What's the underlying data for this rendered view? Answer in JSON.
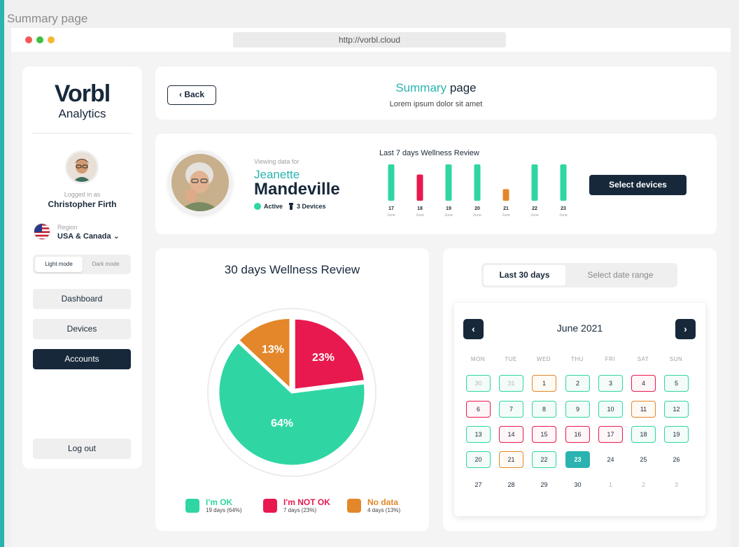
{
  "window": {
    "title": "Summary page",
    "url": "http://vorbl.cloud"
  },
  "colors": {
    "accent": "#2ab3b0",
    "dark": "#17283a",
    "ok": "#2fd6a3",
    "not_ok": "#e8194f",
    "no_data": "#e3872a"
  },
  "sidebar": {
    "logo_word": "Vorbl",
    "logo_sub": "Analytics",
    "logged_label": "Logged in as",
    "user_name": "Christopher Firth",
    "region_label": "Region",
    "region_value": "USA & Canada",
    "mode_light": "Light mode",
    "mode_dark": "Dark mode",
    "nav": {
      "dashboard": "Dashboard",
      "devices": "Devices",
      "accounts": "Accounts",
      "logout": "Log out"
    }
  },
  "header": {
    "back": "Back",
    "title_accent": "Summary",
    "title_rest": "page",
    "subtitle": "Lorem ipsum dolor sit amet"
  },
  "profile": {
    "viewing_label": "Viewing data for",
    "first_name": "Jeanette",
    "last_name": "Mandeville",
    "status": "Active",
    "devices": "3 Devices",
    "weekly_title": "Last 7 days Wellness Review",
    "select_devices": "Select devices"
  },
  "weekly": [
    {
      "day": "17",
      "month": "June",
      "status": "ok",
      "level": 1.0
    },
    {
      "day": "18",
      "month": "June",
      "status": "not_ok",
      "level": 0.72
    },
    {
      "day": "19",
      "month": "June",
      "status": "ok",
      "level": 1.0
    },
    {
      "day": "20",
      "month": "June",
      "status": "ok",
      "level": 1.0
    },
    {
      "day": "21",
      "month": "June",
      "status": "no_data",
      "level": 0.32
    },
    {
      "day": "22",
      "month": "June",
      "status": "ok",
      "level": 1.0
    },
    {
      "day": "23",
      "month": "June",
      "status": "ok",
      "level": 1.0
    }
  ],
  "pie": {
    "title": "30 days Wellness Review",
    "slices": [
      {
        "label": "I'm OK",
        "percent": 64,
        "sub": "19 days (64%)",
        "color": "#2fd6a3"
      },
      {
        "label": "I'm NOT OK",
        "percent": 23,
        "sub": "7 days (23%)",
        "color": "#e8194f"
      },
      {
        "label": "No data",
        "percent": 13,
        "sub": "4 days (13%)",
        "color": "#e3872a"
      }
    ]
  },
  "calendar": {
    "tab_active": "Last 30 days",
    "tab_inactive": "Select date range",
    "month": "June 2021",
    "weekdays": [
      "MON",
      "TUE",
      "WED",
      "THU",
      "FRI",
      "SAT",
      "SUN"
    ],
    "days": [
      {
        "n": "30",
        "s": "ok",
        "m": true
      },
      {
        "n": "31",
        "s": "ok",
        "m": true
      },
      {
        "n": "1",
        "s": "nodata"
      },
      {
        "n": "2",
        "s": "ok"
      },
      {
        "n": "3",
        "s": "ok"
      },
      {
        "n": "4",
        "s": "notok"
      },
      {
        "n": "5",
        "s": "ok"
      },
      {
        "n": "6",
        "s": "notok"
      },
      {
        "n": "7",
        "s": "ok"
      },
      {
        "n": "8",
        "s": "ok"
      },
      {
        "n": "9",
        "s": "ok"
      },
      {
        "n": "10",
        "s": "ok"
      },
      {
        "n": "11",
        "s": "nodata"
      },
      {
        "n": "12",
        "s": "ok"
      },
      {
        "n": "13",
        "s": "ok"
      },
      {
        "n": "14",
        "s": "notok"
      },
      {
        "n": "15",
        "s": "notok"
      },
      {
        "n": "16",
        "s": "notok"
      },
      {
        "n": "17",
        "s": "notok"
      },
      {
        "n": "18",
        "s": "ok"
      },
      {
        "n": "19",
        "s": "ok"
      },
      {
        "n": "20",
        "s": "ok"
      },
      {
        "n": "21",
        "s": "nodata"
      },
      {
        "n": "22",
        "s": "ok"
      },
      {
        "n": "23",
        "s": "today"
      },
      {
        "n": "24",
        "s": "plain"
      },
      {
        "n": "25",
        "s": "plain"
      },
      {
        "n": "26",
        "s": "plain"
      },
      {
        "n": "27",
        "s": "plain"
      },
      {
        "n": "28",
        "s": "plain"
      },
      {
        "n": "29",
        "s": "plain"
      },
      {
        "n": "30",
        "s": "plain"
      },
      {
        "n": "1",
        "s": "plain",
        "m": true
      },
      {
        "n": "2",
        "s": "plain",
        "m": true
      },
      {
        "n": "3",
        "s": "plain",
        "m": true
      }
    ]
  }
}
